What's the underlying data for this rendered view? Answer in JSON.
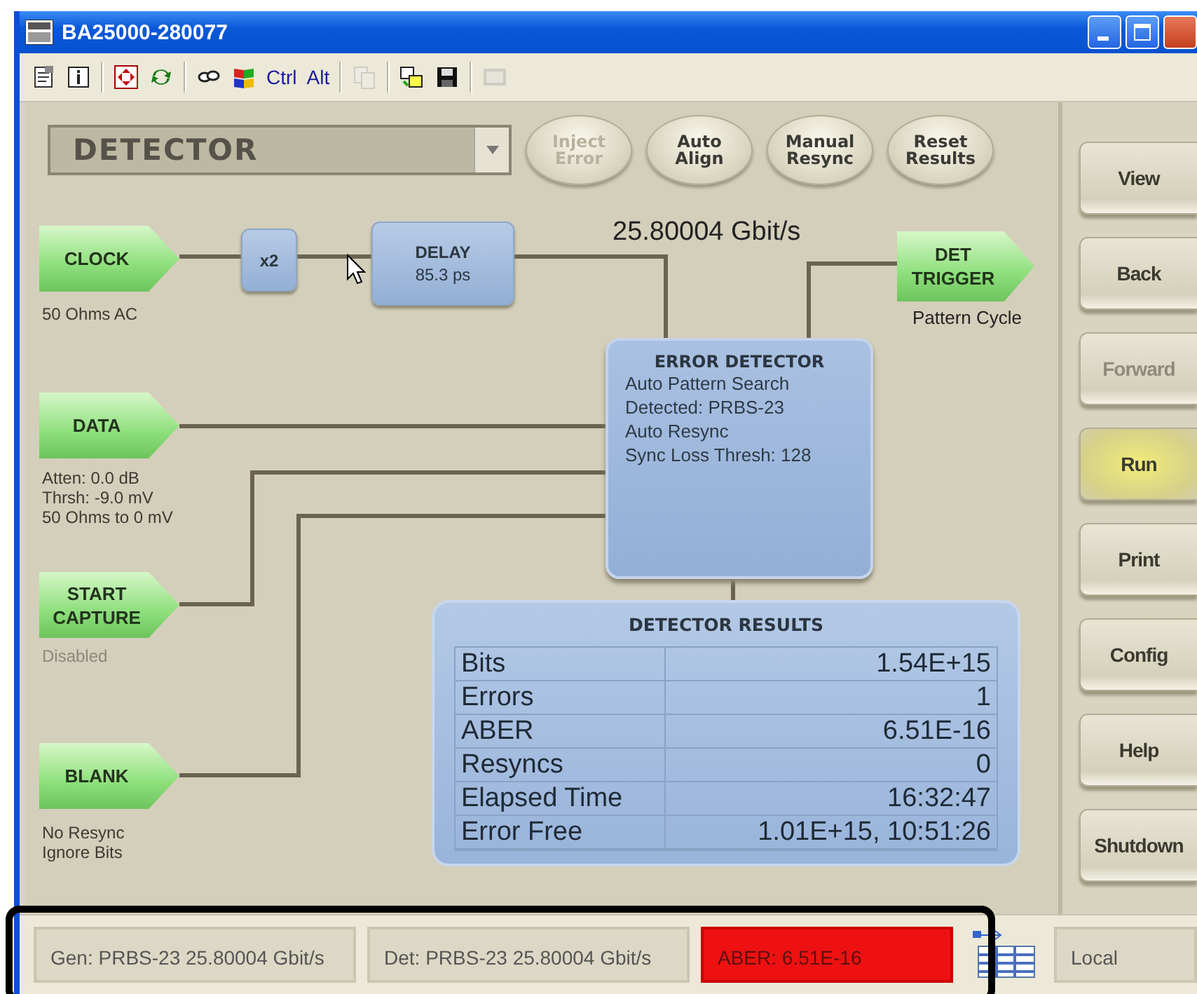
{
  "window": {
    "title": "BA25000-280077"
  },
  "toolbar": [
    {
      "kind": "icon",
      "disabled": false
    },
    {
      "kind": "icon",
      "disabled": false
    },
    {
      "kind": "separator"
    },
    {
      "kind": "icon",
      "disabled": false
    },
    {
      "kind": "icon",
      "disabled": false
    },
    {
      "kind": "separator"
    },
    {
      "kind": "icon",
      "disabled": false
    },
    {
      "kind": "icon",
      "disabled": false
    },
    {
      "kind": "text",
      "label": "Ctrl",
      "disabled": false
    },
    {
      "kind": "text",
      "label": "Alt",
      "disabled": false
    },
    {
      "kind": "separator"
    },
    {
      "kind": "icon",
      "disabled": true
    },
    {
      "kind": "separator"
    },
    {
      "kind": "icon",
      "disabled": false
    },
    {
      "kind": "icon",
      "disabled": false
    },
    {
      "kind": "separator"
    },
    {
      "kind": "icon",
      "disabled": true
    }
  ],
  "mode_selector": {
    "value": "DETECTOR"
  },
  "action_buttons": [
    {
      "label": "Inject Error",
      "disabled": true
    },
    {
      "label": "Auto Align",
      "disabled": false
    },
    {
      "label": "Manual Resync",
      "disabled": false
    },
    {
      "label": "Reset Results",
      "disabled": false
    }
  ],
  "diagram": {
    "rate": "25.80004 Gbit/s",
    "inputs": [
      {
        "label": "CLOCK",
        "notes": [
          "50 Ohms AC"
        ],
        "disabled": false
      },
      {
        "label": "DATA",
        "notes": [
          "Atten: 0.0 dB",
          "Thrsh: -9.0 mV",
          "50 Ohms to 0 mV"
        ],
        "disabled": false
      },
      {
        "label": "START CAPTURE",
        "notes": [
          "Disabled"
        ],
        "disabled": true
      },
      {
        "label": "BLANK",
        "notes": [
          "No Resync",
          "Ignore Bits"
        ],
        "disabled": false
      }
    ],
    "multiplier": "x2",
    "delay": {
      "title": "DELAY",
      "value": "85.3 ps"
    },
    "trigger": {
      "label": "DET TRIGGER",
      "note": "Pattern Cycle"
    },
    "error_detector": {
      "title": "ERROR DETECTOR",
      "lines": [
        "Auto Pattern Search",
        "Detected: PRBS-23",
        "Auto Resync",
        "Sync Loss Thresh: 128"
      ]
    },
    "results": {
      "title": "DETECTOR RESULTS",
      "rows": [
        {
          "label": "Bits",
          "value": "1.54E+15"
        },
        {
          "label": "Errors",
          "value": "1"
        },
        {
          "label": "ABER",
          "value": "6.51E-16"
        },
        {
          "label": "Resyncs",
          "value": "0"
        },
        {
          "label": "Elapsed Time",
          "value": "16:32:47"
        },
        {
          "label": "Error Free",
          "value": "1.01E+15, 10:51:26"
        }
      ]
    }
  },
  "side_buttons": [
    {
      "label": "View",
      "disabled": false,
      "active": false
    },
    {
      "label": "Back",
      "disabled": false,
      "active": false
    },
    {
      "label": "Forward",
      "disabled": true,
      "active": false
    },
    {
      "label": "Run",
      "disabled": false,
      "active": true
    },
    {
      "label": "Print",
      "disabled": false,
      "active": false
    },
    {
      "label": "Config",
      "disabled": false,
      "active": false
    },
    {
      "label": "Help",
      "disabled": false,
      "active": false
    },
    {
      "label": "Shutdown",
      "disabled": false,
      "active": false
    }
  ],
  "status_bar": {
    "fields": [
      {
        "text": "Gen: PRBS-23 25.80004 Gbit/s",
        "alert": false
      },
      {
        "text": "Det: PRBS-23 25.80004 Gbit/s",
        "alert": false
      },
      {
        "text": "ABER: 6.51E-16",
        "alert": true
      }
    ],
    "mode": "Local"
  }
}
